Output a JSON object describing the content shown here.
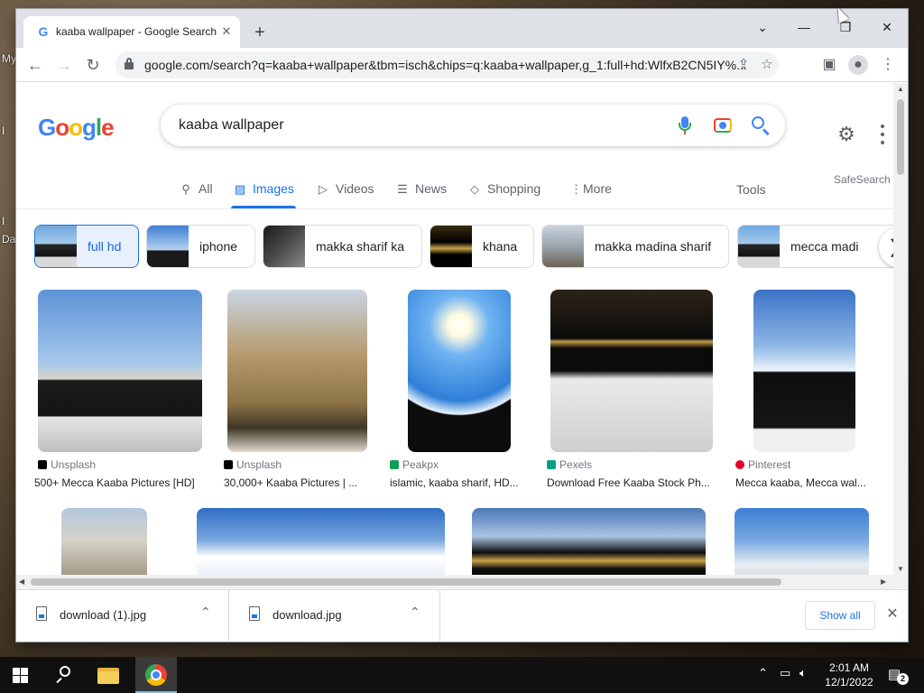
{
  "desktop": {
    "frag1": "My",
    "frag2": "I",
    "frag3": "I",
    "frag4": "Da"
  },
  "browser": {
    "tab_title": "kaaba wallpaper - Google Search",
    "tab_favicon": "G",
    "url": "google.com/search?q=kaaba+wallpaper&tbm=isch&chips=q:kaaba+wallpaper,g_1:full+hd:WlfxB2CN5IY%...",
    "icons": [
      "back-icon",
      "forward-icon",
      "reload-icon",
      "lock-icon",
      "share-icon",
      "star-icon",
      "sidepanel-icon",
      "profile-icon",
      "menu-icon"
    ]
  },
  "google": {
    "logo_letters": [
      "G",
      "o",
      "o",
      "g",
      "l",
      "e"
    ],
    "query": "kaaba wallpaper",
    "nav": {
      "all": "All",
      "images": "Images",
      "videos": "Videos",
      "news": "News",
      "shopping": "Shopping",
      "more": "More",
      "tools": "Tools",
      "safesearch": "SafeSearch"
    },
    "chips": [
      "full hd",
      "iphone",
      "makka sharif ka",
      "khana",
      "makka madina sharif",
      "mecca madi"
    ],
    "results": [
      {
        "source": "Unsplash",
        "caption": "500+ Mecca Kaaba Pictures [HD]",
        "source_color": "#000000"
      },
      {
        "source": "Unsplash",
        "caption": "30,000+ Kaaba Pictures | ...",
        "source_color": "#000000"
      },
      {
        "source": "Peakpx",
        "caption": "islamic, kaaba sharif, HD...",
        "source_color": "#0f9d58"
      },
      {
        "source": "Pexels",
        "caption": "Download Free Kaaba Stock Ph...",
        "source_color": "#05a081"
      },
      {
        "source": "Pinterest",
        "caption": "Mecca kaaba, Mecca wal...",
        "source_color": "#e60023"
      }
    ]
  },
  "downloads": {
    "items": [
      "download (1).jpg",
      "download.jpg"
    ],
    "show_all": "Show all"
  },
  "taskbar": {
    "time": "2:01 AM",
    "date": "12/1/2022",
    "notifications": "2"
  }
}
